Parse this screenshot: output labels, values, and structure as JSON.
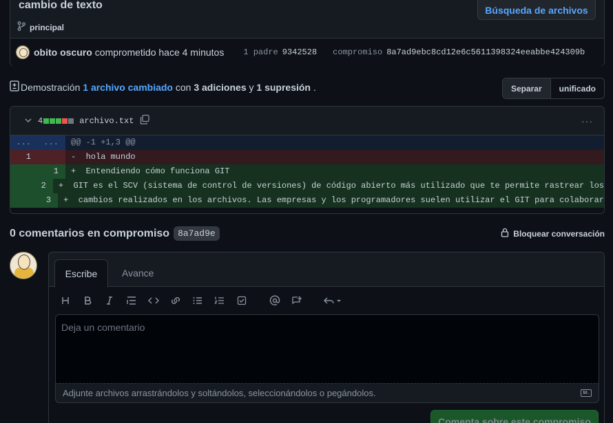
{
  "commit": {
    "title": "cambio de texto",
    "branch": "principal",
    "browse_label": "Búsqueda de archivos",
    "author": "obito oscuro",
    "committed_text": "comprometido hace 4 minutos",
    "parent_label": "1 padre",
    "parent_sha": "9342528",
    "commit_label": "compromiso",
    "commit_sha": "8a7ad9ebc8cd12e6c5611398324eeabbe424309b"
  },
  "summary": {
    "prefix": "Demostración",
    "files_changed": "1 archivo cambiado",
    "with": "con",
    "additions": "3 adiciones",
    "and": "y",
    "deletions": "1 supresión",
    "end": "."
  },
  "view_toggle": {
    "split": "Separar",
    "unified": "unificado"
  },
  "diff": {
    "count": "4",
    "filename": "archivo.txt",
    "kebab": "···",
    "stat_colors": [
      "#3fb950",
      "#3fb950",
      "#3fb950",
      "#f85149",
      "#6e7681"
    ],
    "hunk": {
      "left": "...",
      "right": "...",
      "text": "@@ -1 +1,3 @@"
    },
    "lines": [
      {
        "type": "del",
        "old": "1",
        "new": "",
        "text": "-  hola mundo"
      },
      {
        "type": "add",
        "old": "",
        "new": "1",
        "text": "+  Entendiendo cómo funciona GIT"
      },
      {
        "type": "add",
        "old": "",
        "new": "2",
        "text": "+  GIT es el SCV (sistema de control de versiones) de código abierto más utilizado que te permite rastrear los"
      },
      {
        "type": "add",
        "old": "",
        "new": "3",
        "text": "+  cambios realizados en los archivos. Las empresas y los programadores suelen utilizar el GIT para colaborar"
      }
    ]
  },
  "comments": {
    "title": "0 comentarios en compromiso",
    "sha": "8a7ad9e",
    "lock_label": "Bloquear conversación"
  },
  "editor": {
    "tab_write": "Escribe",
    "tab_preview": "Avance",
    "placeholder": "Deja un comentario",
    "attach_text": "Adjunte archivos arrastrándolos y soltándolos, seleccionándolos o pegándolos.",
    "md_badge": "M↓",
    "submit_label": "Comenta sobre este compromiso"
  },
  "icons": {
    "branch": "git-branch-icon",
    "file_diff": "file-diff-icon",
    "copy": "copy-icon",
    "lock": "lock-icon",
    "chevron": "chevron-down-icon"
  }
}
